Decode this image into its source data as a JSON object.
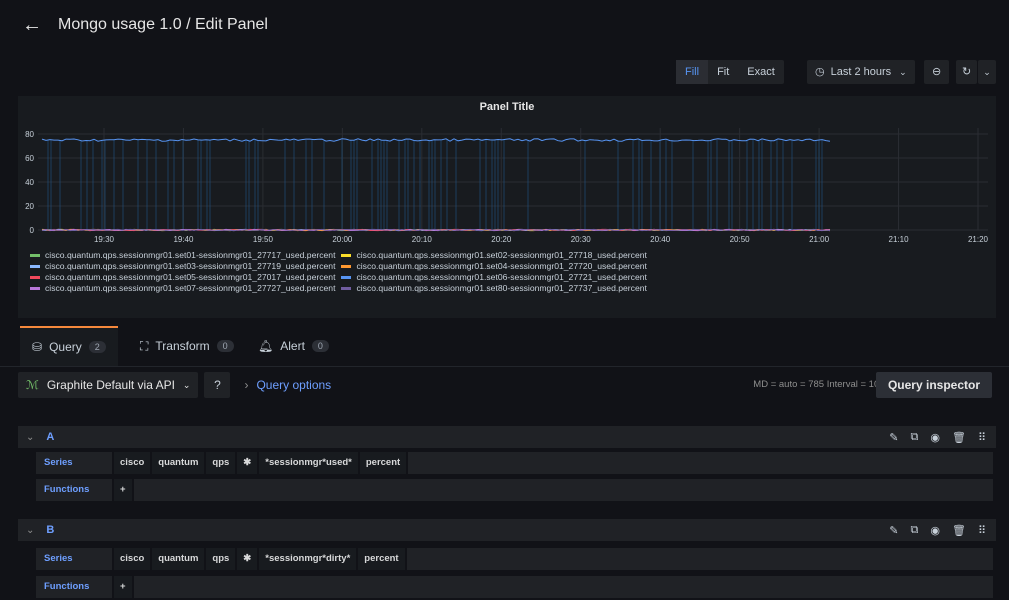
{
  "header": {
    "title": "Mongo usage 1.0 / Edit Panel"
  },
  "toolbar": {
    "view_modes": [
      "Fill",
      "Fit",
      "Exact"
    ],
    "active_mode": "Fill",
    "time_range": "Last 2 hours"
  },
  "panel": {
    "title": "Panel Title",
    "chart_data": {
      "type": "line",
      "title": "Panel Title",
      "x_ticks": [
        "19:30",
        "19:40",
        "19:50",
        "20:00",
        "20:10",
        "20:20",
        "20:30",
        "20:40",
        "20:50",
        "21:00",
        "21:10",
        "21:20"
      ],
      "y_ticks": [
        0,
        20,
        40,
        60,
        80
      ],
      "ylim": [
        0,
        85
      ],
      "grid": true,
      "legend_position": "bottom",
      "series": [
        {
          "name": "cisco.quantum.qps.sessionmgr01.set01-sessionmgr01_27717_used.percent",
          "color": "#73bf69",
          "level": 0
        },
        {
          "name": "cisco.quantum.qps.sessionmgr01.set02-sessionmgr01_27718_used.percent",
          "color": "#fade2a",
          "level": 0
        },
        {
          "name": "cisco.quantum.qps.sessionmgr01.set03-sessionmgr01_27719_used.percent",
          "color": "#8ab8ff",
          "level": 0
        },
        {
          "name": "cisco.quantum.qps.sessionmgr01.set04-sessionmgr01_27720_used.percent",
          "color": "#ff9830",
          "level": 0
        },
        {
          "name": "cisco.quantum.qps.sessionmgr01.set05-sessionmgr01_27017_used.percent",
          "color": "#f2495c",
          "level": 0
        },
        {
          "name": "cisco.quantum.qps.sessionmgr01.set06-sessionmgr01_27721_used.percent",
          "color": "#5794f2",
          "level": 75
        },
        {
          "name": "cisco.quantum.qps.sessionmgr01.set07-sessionmgr01_27727_used.percent",
          "color": "#b877d9",
          "level": 0
        },
        {
          "name": "cisco.quantum.qps.sessionmgr01.set80-sessionmgr01_27737_used.percent",
          "color": "#705da0",
          "level": 0
        }
      ]
    }
  },
  "tabs": [
    {
      "label": "Query",
      "count": "2"
    },
    {
      "label": "Transform",
      "count": "0"
    },
    {
      "label": "Alert",
      "count": "0"
    }
  ],
  "query_bar": {
    "datasource": "Graphite Default via API",
    "query_options": "Query options",
    "meta": "MD = auto = 785   Interval = 10s",
    "inspector": "Query inspector"
  },
  "queries": [
    {
      "ref": "A",
      "series_label": "Series",
      "functions_label": "Functions",
      "segments": [
        "cisco",
        "quantum",
        "qps",
        "✱",
        "*sessionmgr*used*",
        "percent"
      ]
    },
    {
      "ref": "B",
      "series_label": "Series",
      "functions_label": "Functions",
      "segments": [
        "cisco",
        "quantum",
        "qps",
        "✱",
        "*sessionmgr*dirty*",
        "percent"
      ]
    }
  ],
  "plus": "+"
}
